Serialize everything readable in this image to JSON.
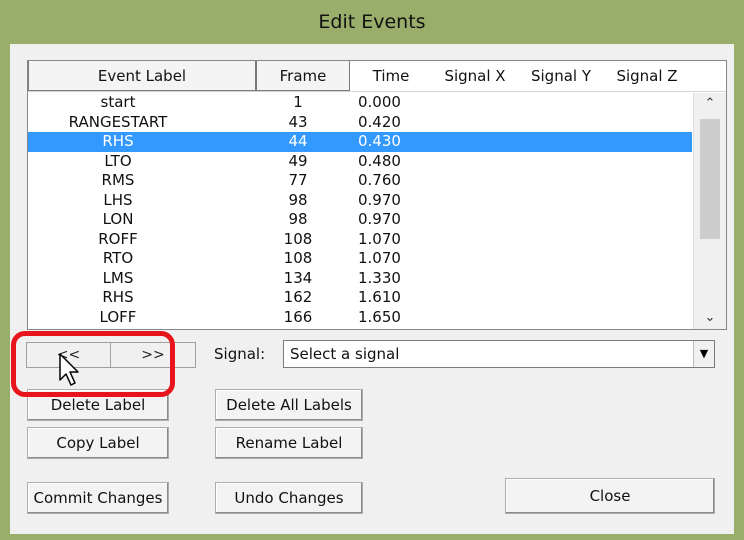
{
  "window": {
    "title": "Edit Events"
  },
  "table": {
    "columns": [
      "Event Label",
      "Frame",
      "Time",
      "Signal X",
      "Signal Y",
      "Signal Z"
    ],
    "rows": [
      {
        "label": "start",
        "frame": "1",
        "time": "0.000"
      },
      {
        "label": "RANGESTART",
        "frame": "43",
        "time": "0.420"
      },
      {
        "label": "RHS",
        "frame": "44",
        "time": "0.430",
        "selected": true
      },
      {
        "label": "LTO",
        "frame": "49",
        "time": "0.480"
      },
      {
        "label": "RMS",
        "frame": "77",
        "time": "0.760"
      },
      {
        "label": "LHS",
        "frame": "98",
        "time": "0.970"
      },
      {
        "label": "LON",
        "frame": "98",
        "time": "0.970"
      },
      {
        "label": "ROFF",
        "frame": "108",
        "time": "1.070"
      },
      {
        "label": "RTO",
        "frame": "108",
        "time": "1.070"
      },
      {
        "label": "LMS",
        "frame": "134",
        "time": "1.330"
      },
      {
        "label": "RHS",
        "frame": "162",
        "time": "1.610"
      },
      {
        "label": "LOFF",
        "frame": "166",
        "time": "1.650"
      }
    ]
  },
  "nav": {
    "prev_label": "<<",
    "next_label": ">>"
  },
  "signal": {
    "label": "Signal:",
    "value": "Select a signal"
  },
  "buttons": {
    "delete_label": "Delete Label",
    "delete_all_labels": "Delete All Labels",
    "copy_label": "Copy Label",
    "rename_label": "Rename Label",
    "commit_changes": "Commit Changes",
    "undo_changes": "Undo Changes",
    "close": "Close"
  },
  "colors": {
    "selection": "#3399ff",
    "highlight_ring": "#e8141b",
    "window_frame": "#98ae6a"
  },
  "icons": {
    "scroll_up": "chevron-up-icon",
    "scroll_down": "chevron-down-icon",
    "dropdown": "caret-down-icon",
    "cursor": "mouse-pointer-icon"
  }
}
